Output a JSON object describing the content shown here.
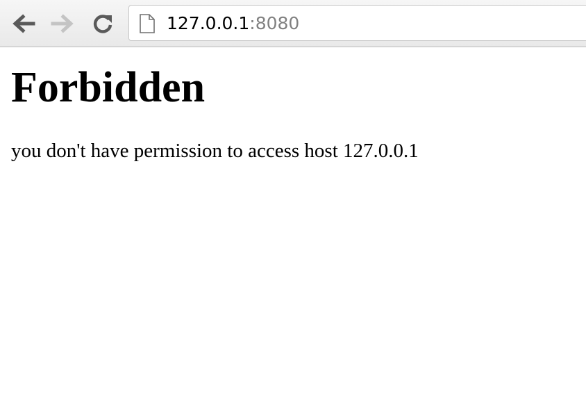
{
  "browser": {
    "address_bar": {
      "host": "127.0.0.1",
      "port": ":8080"
    },
    "icons": {
      "back": "arrow-left-icon",
      "forward": "arrow-right-icon",
      "reload": "reload-icon",
      "page": "page-icon"
    }
  },
  "page": {
    "heading": "Forbidden",
    "message": "you don't have permission to access host 127.0.0.1"
  }
}
